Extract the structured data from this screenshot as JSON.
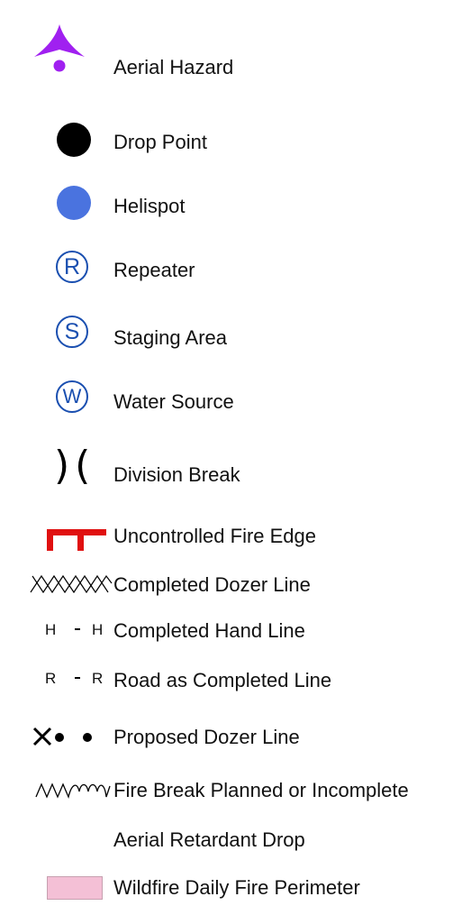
{
  "legend": {
    "items": [
      {
        "label": "Aerial Hazard",
        "symbol": "aerial-hazard-icon",
        "color": "#a020f0"
      },
      {
        "label": "Drop Point",
        "symbol": "drop-point-icon",
        "color": "#000000"
      },
      {
        "label": "Helispot",
        "symbol": "helispot-icon",
        "color": "#4a73df"
      },
      {
        "label": "Repeater",
        "symbol": "repeater-icon",
        "letter": "R",
        "color": "#1a4fb0"
      },
      {
        "label": "Staging Area",
        "symbol": "staging-area-icon",
        "letter": "S",
        "color": "#1a4fb0"
      },
      {
        "label": "Water Source",
        "symbol": "water-source-icon",
        "letter": "W",
        "color": "#1a4fb0"
      },
      {
        "label": "Division Break",
        "symbol": "division-break-icon",
        "glyph": ")(",
        "color": "#000000"
      },
      {
        "label": "Uncontrolled Fire Edge",
        "symbol": "uncontrolled-fire-edge-icon",
        "color": "#e01010"
      },
      {
        "label": "Completed Dozer Line",
        "symbol": "completed-dozer-line-icon",
        "color": "#000000"
      },
      {
        "label": "Completed Hand Line",
        "symbol": "completed-hand-line-icon",
        "line_letter": "H",
        "color": "#000000"
      },
      {
        "label": "Road as Completed Line",
        "symbol": "road-completed-line-icon",
        "line_letter": "R",
        "color": "#000000"
      },
      {
        "label": "Proposed Dozer Line",
        "symbol": "proposed-dozer-line-icon",
        "color": "#000000"
      },
      {
        "label": "Fire Break Planned or Incomplete",
        "symbol": "fire-break-planned-icon",
        "color": "#000000"
      },
      {
        "label": "Aerial Retardant Drop",
        "symbol": "aerial-retardant-drop-icon",
        "color": "#ffffff"
      },
      {
        "label": "Wildfire Daily Fire Perimeter",
        "symbol": "fire-perimeter-icon",
        "color": "#f4c0d6"
      }
    ]
  }
}
